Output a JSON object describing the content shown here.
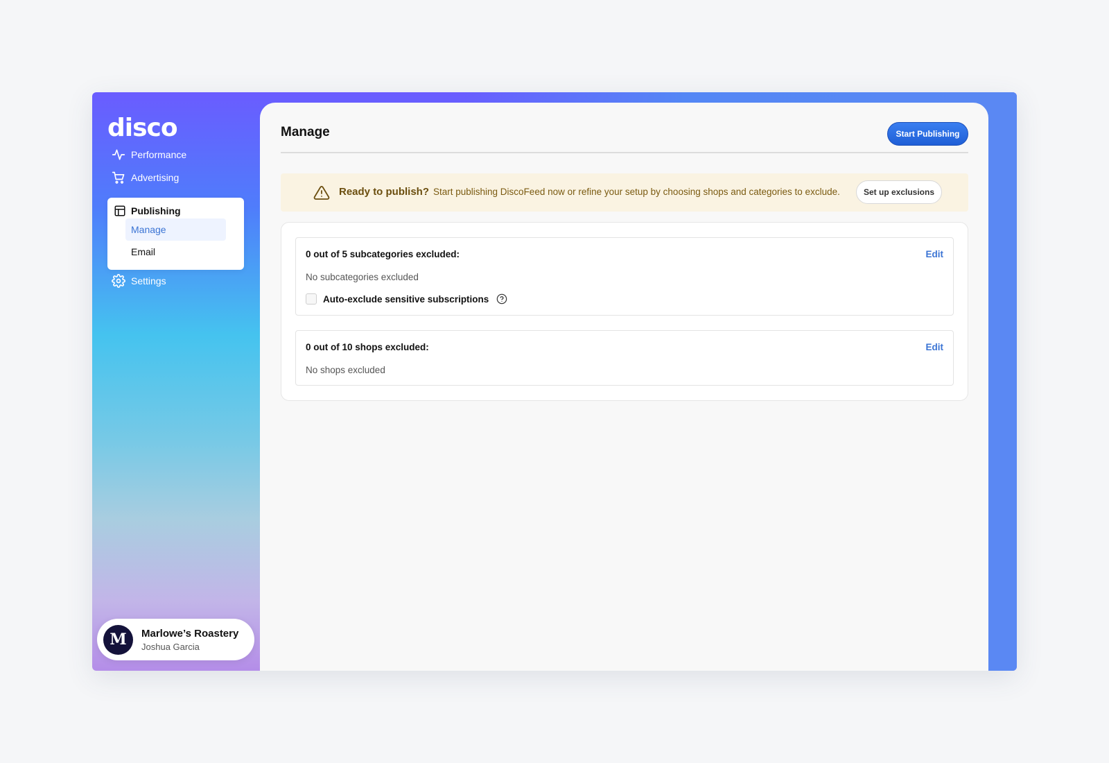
{
  "brand": {
    "logo_text": "disco"
  },
  "sidebar": {
    "items": [
      {
        "label": "Performance",
        "icon": "activity-icon"
      },
      {
        "label": "Advertising",
        "icon": "cart-icon"
      },
      {
        "label": "Publishing",
        "icon": "layout-icon"
      },
      {
        "label": "Settings",
        "icon": "gear-icon"
      }
    ],
    "publishing_sub": [
      {
        "label": "Manage",
        "active": true
      },
      {
        "label": "Email",
        "active": false
      }
    ]
  },
  "account": {
    "avatar_letter": "M",
    "name": "Marlowe’s Roastery",
    "user": "Joshua Garcia"
  },
  "main": {
    "title": "Manage",
    "start_button": "Start Publishing",
    "alert": {
      "title": "Ready to publish?",
      "text": "Start publishing DiscoFeed now or refine your setup by choosing shops and categories to exclude.",
      "button": "Set up exclusions"
    },
    "subcategories": {
      "heading": "0 out of 5 subcategories excluded:",
      "edit": "Edit",
      "status": "No subcategories excluded",
      "checkbox_label": "Auto-exclude sensitive subscriptions"
    },
    "shops": {
      "heading": "0 out of 10 shops excluded:",
      "edit": "Edit",
      "status": "No shops excluded"
    }
  },
  "colors": {
    "accent": "#3b74d4",
    "primary_button": "#1f5fd6",
    "alert_bg": "#faf3e2",
    "alert_text": "#7a5a10"
  }
}
